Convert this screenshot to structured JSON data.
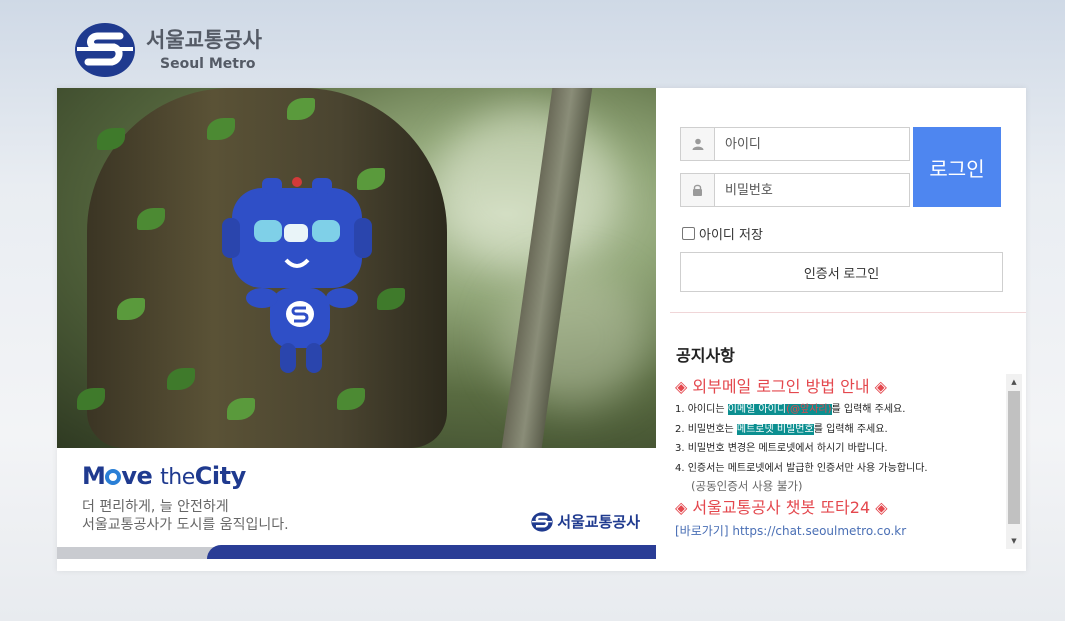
{
  "header": {
    "logo_ko": "서울교통공사",
    "logo_en": "Seoul Metro"
  },
  "banner": {
    "slogan_move": "M",
    "slogan_ve": "ve",
    "slogan_the": "the",
    "slogan_city": "City",
    "tagline_1": "더 편리하게, 늘 안전하게",
    "tagline_2": "서울교통공사가 도시를 움직입니다.",
    "logo_ko": "서울교통공사"
  },
  "login": {
    "id_placeholder": "아이디",
    "pw_placeholder": "비밀번호",
    "login_label": "로그인",
    "save_id_label": "아이디 저장",
    "cert_login_label": "인증서 로그인"
  },
  "notice": {
    "title": "공지사항",
    "heading_1": "◈ 외부메일 로그인 방법 안내 ◈",
    "item_1_pre": "1. 아이디는 ",
    "item_1_hl": "이메일 아이디",
    "item_1_hl_red": "(@앞자리)",
    "item_1_post": "를 입력해 주세요.",
    "item_2_pre": "2. 비밀번호는 ",
    "item_2_hl": "메트로넷 비밀번호",
    "item_2_post": "를 입력해 주세요.",
    "item_3": "3. 비밀번호 변경은 메트로넷에서 하시기 바랍니다.",
    "item_4": "4. 인증서는 메트로넷에서 발급한 인증서만 사용 가능합니다.",
    "item_4_sub": "(공동인증서 사용 불가)",
    "heading_2": "◈ 서울교통공사 챗봇 또타24 ◈",
    "link_label": "[바로가기]",
    "link_url": "https://chat.seoulmetro.co.kr"
  },
  "colors": {
    "brand_blue": "#1f3a8f",
    "login_button": "#4e86f0",
    "notice_red": "#e4484e",
    "highlight_teal": "#0b8f90"
  },
  "icons": {
    "user": "user-icon",
    "lock": "lock-icon"
  }
}
